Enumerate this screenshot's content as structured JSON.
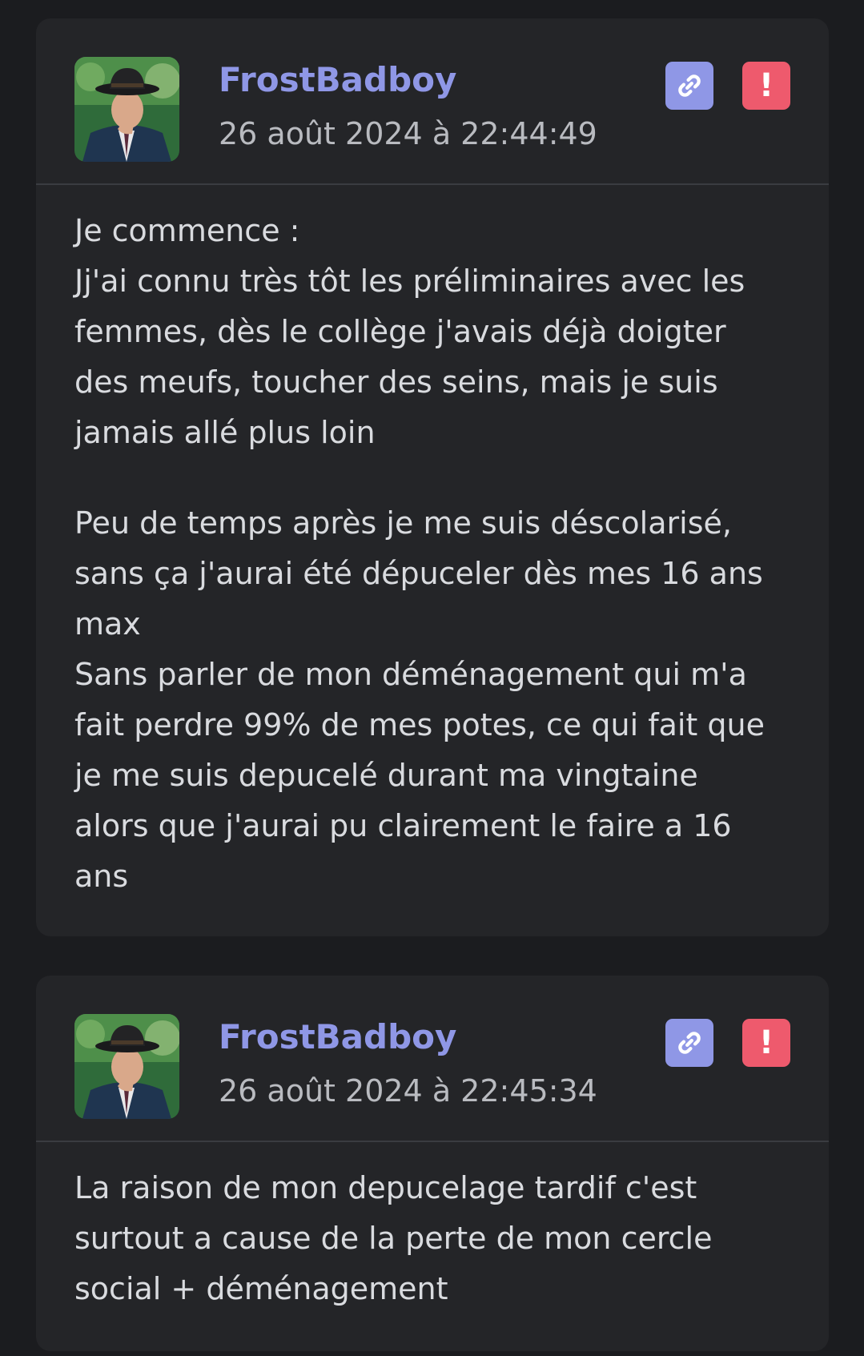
{
  "posts": [
    {
      "author": "FrostBadboy",
      "date": "26 août 2024 à 22:44:49",
      "icons": {
        "link": "link-icon",
        "report": "exclamation-icon"
      },
      "colors": {
        "author": "#8f97e6",
        "link_button": "#8f97e6",
        "report_button": "#ee5a6d"
      },
      "paragraphs": [
        [
          "Je commence :",
          "Jj'ai connu très tôt les préliminaires avec les",
          "femmes, dès le collège j'avais déjà doigter",
          "des meufs, toucher des seins, mais je suis",
          "jamais allé plus loin"
        ],
        [
          "Peu de temps après je me suis déscolarisé,",
          "sans ça j'aurai été dépuceler dès mes 16 ans",
          "max",
          "Sans parler de mon déménagement qui m'a",
          "fait perdre 99% de mes potes, ce qui fait que",
          "je me suis depucelé durant ma vingtaine",
          "alors que j'aurai pu clairement le faire a 16",
          "ans"
        ]
      ]
    },
    {
      "author": "FrostBadboy",
      "date": "26 août 2024 à 22:45:34",
      "icons": {
        "link": "link-icon",
        "report": "exclamation-icon"
      },
      "paragraphs": [
        [
          "La raison de mon depucelage tardif c'est",
          "surtout a cause de la perte de mon cercle",
          "social + déménagement"
        ]
      ]
    }
  ],
  "report_symbol": "!"
}
